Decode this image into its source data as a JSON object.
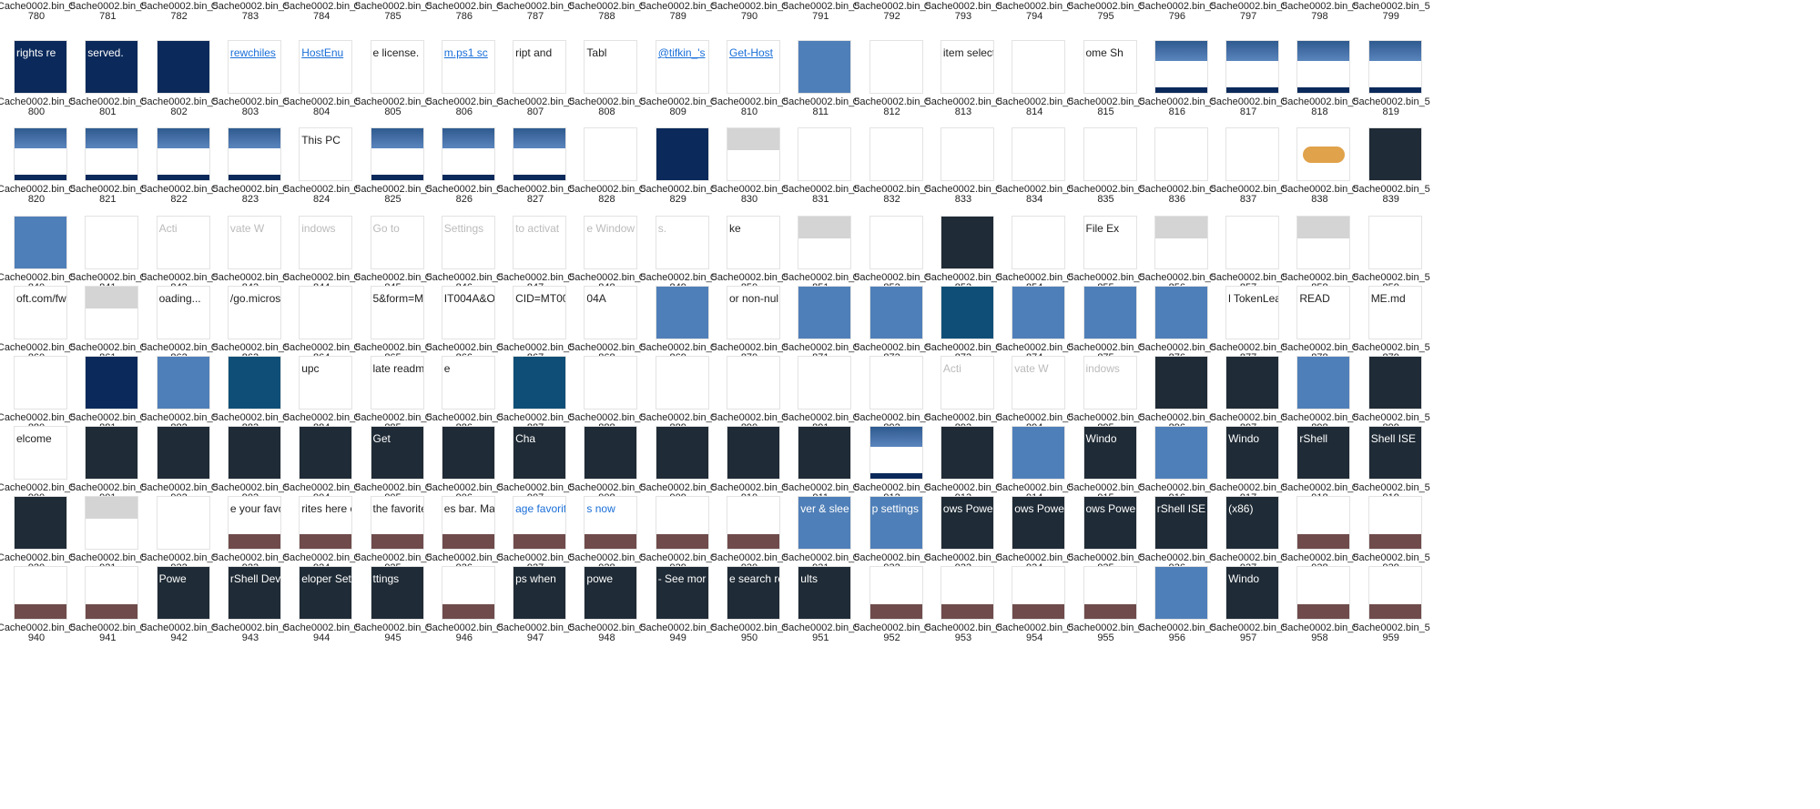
{
  "caption_prefix": "Cache0002.bin_5",
  "header_nums": [
    "780",
    "781",
    "782",
    "783",
    "784",
    "785",
    "786",
    "787",
    "788",
    "789",
    "790",
    "791",
    "792",
    "793",
    "794",
    "795",
    "796",
    "797",
    "798",
    "799"
  ],
  "rows": [
    {
      "tiles": [
        {
          "n": "800",
          "s": "navyfull",
          "t": "rights re",
          "c": "#ffffff"
        },
        {
          "n": "801",
          "s": "navyfull",
          "t": "served.",
          "c": "#ffffff"
        },
        {
          "n": "802",
          "s": "navyfull"
        },
        {
          "n": "803",
          "s": "text",
          "t": "rewchiles",
          "c": "#1a6fd8"
        },
        {
          "n": "804",
          "s": "text",
          "t": "HostEnu",
          "c": "#1a6fd8"
        },
        {
          "n": "805",
          "s": "text",
          "t": "e license."
        },
        {
          "n": "806",
          "s": "text",
          "t": "m.ps1 sc",
          "c": "#1a6fd8"
        },
        {
          "n": "807",
          "s": "text",
          "t": "ript and"
        },
        {
          "n": "808",
          "s": "text",
          "t": "Tabl"
        },
        {
          "n": "809",
          "s": "text",
          "t": "@tifkin_'s",
          "c": "#1a6fd8"
        },
        {
          "n": "810",
          "s": "text",
          "t": "Get-Host",
          "c": "#1a6fd8"
        },
        {
          "n": "811",
          "s": "blue"
        },
        {
          "n": "812",
          "s": "white"
        },
        {
          "n": "813",
          "s": "text",
          "t": "item selecte"
        },
        {
          "n": "814",
          "s": "white"
        },
        {
          "n": "815",
          "s": "text",
          "t": "ome  Sh"
        },
        {
          "n": "816",
          "s": "navybottom"
        },
        {
          "n": "817",
          "s": "navybottom"
        },
        {
          "n": "818",
          "s": "navybottom"
        },
        {
          "n": "819",
          "s": "navybottom"
        }
      ]
    },
    {
      "tiles": [
        {
          "n": "820",
          "s": "navybottom"
        },
        {
          "n": "821",
          "s": "navybottom"
        },
        {
          "n": "822",
          "s": "navybottom"
        },
        {
          "n": "823",
          "s": "navybottom"
        },
        {
          "n": "824",
          "s": "text",
          "t": "This PC"
        },
        {
          "n": "825",
          "s": "navybottom"
        },
        {
          "n": "826",
          "s": "navybottom"
        },
        {
          "n": "827",
          "s": "navybottom"
        },
        {
          "n": "828",
          "s": "white"
        },
        {
          "n": "829",
          "s": "navyfull"
        },
        {
          "n": "830",
          "s": "gray"
        },
        {
          "n": "831",
          "s": "white"
        },
        {
          "n": "832",
          "s": "white"
        },
        {
          "n": "833",
          "s": "white"
        },
        {
          "n": "834",
          "s": "white"
        },
        {
          "n": "835",
          "s": "white"
        },
        {
          "n": "836",
          "s": "white"
        },
        {
          "n": "837",
          "s": "white"
        },
        {
          "n": "838",
          "s": "bread"
        },
        {
          "n": "839",
          "s": "dark"
        }
      ]
    },
    {
      "tiles": [
        {
          "n": "840",
          "s": "blue"
        },
        {
          "n": "841",
          "s": "white"
        },
        {
          "n": "842",
          "s": "text",
          "t": "Acti",
          "c": "#bbbbbb"
        },
        {
          "n": "843",
          "s": "text",
          "t": "vate W",
          "c": "#bbbbbb"
        },
        {
          "n": "844",
          "s": "text",
          "t": "indows",
          "c": "#bbbbbb"
        },
        {
          "n": "845",
          "s": "text",
          "t": "Go to",
          "c": "#bbbbbb"
        },
        {
          "n": "846",
          "s": "text",
          "t": "Settings",
          "c": "#bbbbbb"
        },
        {
          "n": "847",
          "s": "text",
          "t": "to activat",
          "c": "#bbbbbb"
        },
        {
          "n": "848",
          "s": "text",
          "t": "e Window",
          "c": "#bbbbbb"
        },
        {
          "n": "849",
          "s": "text",
          "t": "s.",
          "c": "#bbbbbb"
        },
        {
          "n": "850",
          "s": "text",
          "t": "ke"
        },
        {
          "n": "851",
          "s": "gray"
        },
        {
          "n": "852",
          "s": "white"
        },
        {
          "n": "853",
          "s": "dark"
        },
        {
          "n": "854",
          "s": "white"
        },
        {
          "n": "855",
          "s": "text",
          "t": "File Ex"
        },
        {
          "n": "856",
          "s": "gray"
        },
        {
          "n": "857",
          "s": "white"
        },
        {
          "n": "858",
          "s": "gray"
        },
        {
          "n": "859",
          "s": "white"
        }
      ]
    },
    {
      "tiles": [
        {
          "n": "860",
          "s": "text",
          "t": "oft.com/fw"
        },
        {
          "n": "861",
          "s": "gray"
        },
        {
          "n": "862",
          "s": "text",
          "t": "oading..."
        },
        {
          "n": "863",
          "s": "text",
          "t": "/go.micros"
        },
        {
          "n": "864",
          "s": "white"
        },
        {
          "n": "865",
          "s": "text",
          "t": "5&form=M"
        },
        {
          "n": "866",
          "s": "text",
          "t": "IT004A&O"
        },
        {
          "n": "867",
          "s": "text",
          "t": "CID=MT00"
        },
        {
          "n": "868",
          "s": "text",
          "t": "04A"
        },
        {
          "n": "869",
          "s": "blue"
        },
        {
          "n": "870",
          "s": "text",
          "t": "or non-nul"
        },
        {
          "n": "871",
          "s": "blue"
        },
        {
          "n": "872",
          "s": "blue"
        },
        {
          "n": "873",
          "s": "teal"
        },
        {
          "n": "874",
          "s": "blue"
        },
        {
          "n": "875",
          "s": "blue"
        },
        {
          "n": "876",
          "s": "blue"
        },
        {
          "n": "877",
          "s": "text",
          "t": "l TokenLea"
        },
        {
          "n": "878",
          "s": "text",
          "t": "READ"
        },
        {
          "n": "879",
          "s": "text",
          "t": "ME.md"
        }
      ]
    },
    {
      "tiles": [
        {
          "n": "880",
          "s": "white"
        },
        {
          "n": "881",
          "s": "navyfull"
        },
        {
          "n": "882",
          "s": "blue"
        },
        {
          "n": "883",
          "s": "teal"
        },
        {
          "n": "884",
          "s": "text",
          "t": "upc"
        },
        {
          "n": "885",
          "s": "text",
          "t": "late readm"
        },
        {
          "n": "886",
          "s": "text",
          "t": "e"
        },
        {
          "n": "887",
          "s": "teal"
        },
        {
          "n": "888",
          "s": "white"
        },
        {
          "n": "889",
          "s": "white"
        },
        {
          "n": "890",
          "s": "white"
        },
        {
          "n": "891",
          "s": "white"
        },
        {
          "n": "892",
          "s": "white"
        },
        {
          "n": "893",
          "s": "text",
          "t": "Acti",
          "c": "#bbbbbb"
        },
        {
          "n": "894",
          "s": "text",
          "t": "vate W",
          "c": "#bbbbbb"
        },
        {
          "n": "895",
          "s": "text",
          "t": "indows",
          "c": "#bbbbbb"
        },
        {
          "n": "896",
          "s": "dark"
        },
        {
          "n": "897",
          "s": "dark"
        },
        {
          "n": "898",
          "s": "blue"
        },
        {
          "n": "899",
          "s": "dark"
        }
      ]
    },
    {
      "tiles": [
        {
          "n": "900",
          "s": "text",
          "t": "elcome"
        },
        {
          "n": "901",
          "s": "dark"
        },
        {
          "n": "902",
          "s": "dark"
        },
        {
          "n": "903",
          "s": "dark"
        },
        {
          "n": "904",
          "s": "dark"
        },
        {
          "n": "905",
          "s": "dark",
          "t": "Get",
          "c": "#ffffff"
        },
        {
          "n": "906",
          "s": "dark"
        },
        {
          "n": "907",
          "s": "dark",
          "t": "Cha",
          "c": "#ffffff"
        },
        {
          "n": "908",
          "s": "dark"
        },
        {
          "n": "909",
          "s": "dark"
        },
        {
          "n": "910",
          "s": "dark"
        },
        {
          "n": "911",
          "s": "dark"
        },
        {
          "n": "912",
          "s": "navybottom"
        },
        {
          "n": "913",
          "s": "dark"
        },
        {
          "n": "914",
          "s": "blue"
        },
        {
          "n": "915",
          "s": "dark",
          "t": "Windo",
          "c": "#ffffff"
        },
        {
          "n": "916",
          "s": "blue"
        },
        {
          "n": "917",
          "s": "dark",
          "t": "Windo",
          "c": "#ffffff"
        },
        {
          "n": "918",
          "s": "dark",
          "t": "rShell",
          "c": "#ffffff"
        },
        {
          "n": "919",
          "s": "dark",
          "t": "Shell ISE",
          "c": "#ffffff"
        }
      ]
    },
    {
      "tiles": [
        {
          "n": "920",
          "s": "dark"
        },
        {
          "n": "921",
          "s": "gray"
        },
        {
          "n": "922",
          "s": "white"
        },
        {
          "n": "923",
          "s": "brownbottom",
          "t": "e your favo"
        },
        {
          "n": "924",
          "s": "brownbottom",
          "t": "rites here or"
        },
        {
          "n": "925",
          "s": "brownbottom",
          "t": "the favorite"
        },
        {
          "n": "926",
          "s": "brownbottom",
          "t": "es bar. Man"
        },
        {
          "n": "927",
          "s": "brownbottom",
          "t": "age favorite",
          "c": "#1a6fd8"
        },
        {
          "n": "928",
          "s": "brownbottom",
          "t": "s now",
          "c": "#1a6fd8"
        },
        {
          "n": "929",
          "s": "brownbottom"
        },
        {
          "n": "930",
          "s": "brownbottom"
        },
        {
          "n": "931",
          "s": "blue",
          "t": "ver & slee",
          "c": "#ffffff"
        },
        {
          "n": "932",
          "s": "blue",
          "t": "p settings",
          "c": "#ffffff"
        },
        {
          "n": "933",
          "s": "dark",
          "t": "ows Powe",
          "c": "#ffffff"
        },
        {
          "n": "934",
          "s": "dark",
          "t": "ows Powe",
          "c": "#ffffff"
        },
        {
          "n": "935",
          "s": "dark",
          "t": "ows Powe",
          "c": "#ffffff"
        },
        {
          "n": "936",
          "s": "dark",
          "t": "rShell ISE",
          "c": "#ffffff"
        },
        {
          "n": "937",
          "s": "dark",
          "t": "(x86)",
          "c": "#ffffff"
        },
        {
          "n": "938",
          "s": "brownbottom"
        },
        {
          "n": "939",
          "s": "brownbottom"
        }
      ]
    },
    {
      "tiles": [
        {
          "n": "940",
          "s": "brownbottom"
        },
        {
          "n": "941",
          "s": "brownbottom"
        },
        {
          "n": "942",
          "s": "dark",
          "t": "Powe",
          "c": "#ffffff"
        },
        {
          "n": "943",
          "s": "dark",
          "t": "rShell Dev",
          "c": "#ffffff"
        },
        {
          "n": "944",
          "s": "dark",
          "t": "eloper Set",
          "c": "#ffffff"
        },
        {
          "n": "945",
          "s": "dark",
          "t": "ttings",
          "c": "#ffffff"
        },
        {
          "n": "946",
          "s": "brownbottom"
        },
        {
          "n": "947",
          "s": "dark",
          "t": "ps when",
          "c": "#ffffff"
        },
        {
          "n": "948",
          "s": "dark",
          "t": "powe",
          "c": "#ffffff"
        },
        {
          "n": "949",
          "s": "dark",
          "t": "- See mor",
          "c": "#ffffff"
        },
        {
          "n": "950",
          "s": "dark",
          "t": "e search re",
          "c": "#ffffff"
        },
        {
          "n": "951",
          "s": "dark",
          "t": "ults",
          "c": "#ffffff"
        },
        {
          "n": "952",
          "s": "brownbottom"
        },
        {
          "n": "953",
          "s": "brownbottom"
        },
        {
          "n": "954",
          "s": "brownbottom"
        },
        {
          "n": "955",
          "s": "brownbottom"
        },
        {
          "n": "956",
          "s": "blue"
        },
        {
          "n": "957",
          "s": "dark",
          "t": "Windo",
          "c": "#ffffff"
        },
        {
          "n": "958",
          "s": "brownbottom"
        },
        {
          "n": "959",
          "s": "brownbottom"
        }
      ]
    }
  ]
}
